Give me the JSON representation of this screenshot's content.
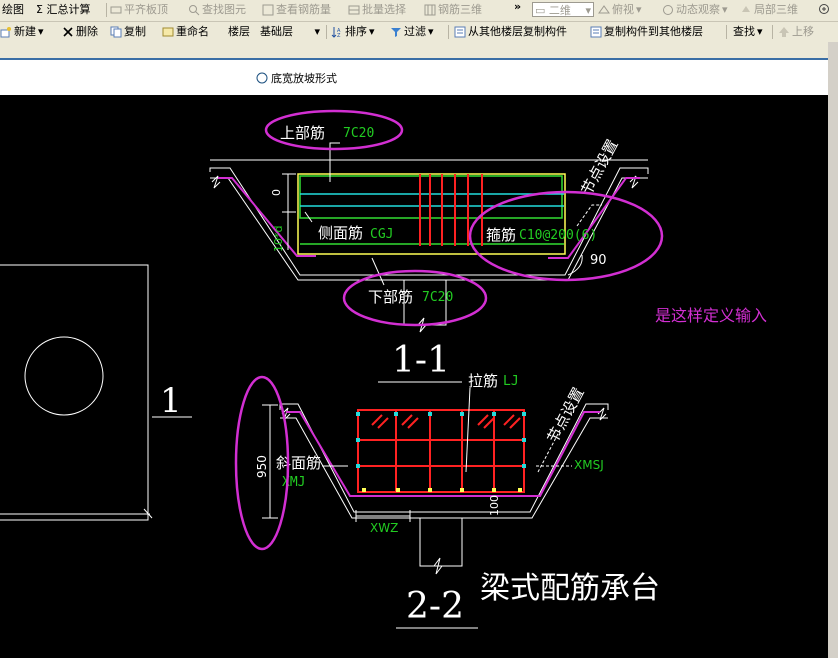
{
  "toolbar1": {
    "draw": "绘图",
    "sum": "Σ 汇总计算",
    "flat_board": "平齐板顶",
    "find_element": "查找图元",
    "view_rebar": "查看钢筋量",
    "batch_select": "批量选择",
    "rebar_3d": "钢筋三维",
    "overflow": "»",
    "view_mode": "二维",
    "view_angle": "俯视",
    "dynamic_view": "动态观察",
    "local_3d": "局部三维"
  },
  "toolbar2": {
    "new": "新建",
    "delete": "删除",
    "copy": "复制",
    "rename": "重命名",
    "floor_label": "楼层",
    "floor_value": "基础层",
    "sort": "排序",
    "filter": "过滤",
    "copy_from_other": "从其他楼层复制构件",
    "copy_to_other": "复制构件到其他楼层",
    "find": "查找",
    "up": "上移"
  },
  "options": {
    "radio_label": "底宽放坡形式"
  },
  "drawing": {
    "sec1_top_name": "上部筋",
    "sec1_top_code": "7C20",
    "sec1_side_name": "侧面筋",
    "sec1_side_code": "CGJ",
    "sec1_stirrup_name": "箍筋",
    "sec1_stirrup_code": "C10@200(6)",
    "sec1_bottom_name": "下部筋",
    "sec1_bottom_code": "7C20",
    "node_setting": "节点设置",
    "dim_zero": "0",
    "dim_10d": "10*d",
    "angle": "90",
    "note": "是这样定义输入",
    "sec1_title": "1-1",
    "left_label": "1",
    "sec2_tie_name": "拉筋",
    "sec2_tie_code": "LJ",
    "sec2_slope_name": "斜面筋",
    "sec2_slope_code": "XMJ",
    "dim_950": "950",
    "dim_100": "100",
    "xwz": "XWZ",
    "xmsj": "XMSJ",
    "sec2_title": "2-2",
    "caption": "梁式配筋承台"
  },
  "colors": {
    "magenta": "#d22fd2",
    "green_rebar": "#33dd33",
    "red_rebar": "#ff2222",
    "cyan_rebar": "#22dddd",
    "yellow": "#ffff55",
    "code_green": "#22cc22"
  }
}
